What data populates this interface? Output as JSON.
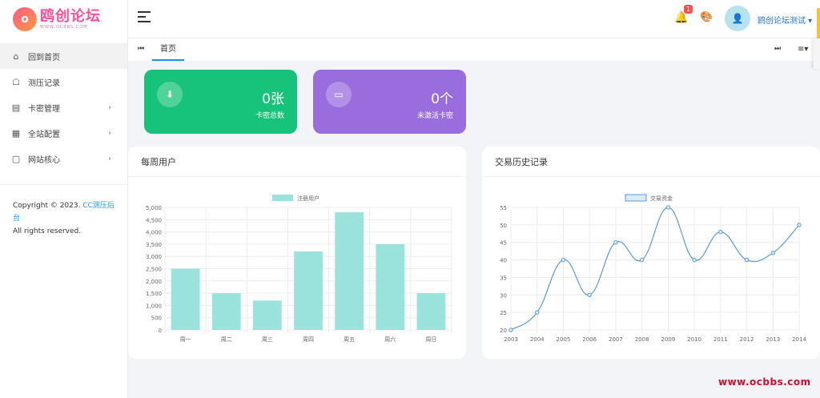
{
  "logo": {
    "title": "鸥创论坛",
    "subtitle": "WWW.OCBBS.COM",
    "mark": "o"
  },
  "sidebar": {
    "items": [
      {
        "label": "回到首页",
        "icon": "home-icon",
        "glyph": "⌂"
      },
      {
        "label": "测压记录",
        "icon": "record-icon",
        "glyph": "☖"
      },
      {
        "label": "卡密管理",
        "icon": "card-icon",
        "glyph": "▤",
        "arrow": "›"
      },
      {
        "label": "全站配置",
        "icon": "calendar-icon",
        "glyph": "▦",
        "arrow": "›"
      },
      {
        "label": "网站核心",
        "icon": "file-icon",
        "glyph": "▢",
        "arrow": "›"
      }
    ]
  },
  "copyright": {
    "prefix": "Copyright © 2023. ",
    "brand": "CC测压后台",
    "suffix": "All rights reserved."
  },
  "header": {
    "bell_glyph": "🔔",
    "notification_count": "1",
    "palette_glyph": "🎨",
    "avatar_glyph": "👤",
    "username": "鸥创论坛测试 ▾"
  },
  "tabs": {
    "first_glyph": "⏮",
    "home": "首页",
    "last_glyph": "⏭",
    "menu_glyph": "≡▾"
  },
  "stats": [
    {
      "value": "0张",
      "label": "卡密总数",
      "glyph": "⬇",
      "color": "#17c37a"
    },
    {
      "value": "0个",
      "label": "未激活卡密",
      "glyph": "▭",
      "color": "#9a6ddf"
    }
  ],
  "cards": {
    "weekly_title": "每周用户",
    "history_title": "交易历史记录"
  },
  "chart_data": [
    {
      "type": "bar",
      "title": "每周用户",
      "categories": [
        "周一",
        "周二",
        "周三",
        "周四",
        "周五",
        "周六",
        "周日"
      ],
      "series": [
        {
          "name": "注册用户",
          "values": [
            2500,
            1500,
            1200,
            3200,
            4800,
            3500,
            1500
          ]
        }
      ],
      "ylim": [
        0,
        5000
      ],
      "yticks": [
        "0",
        "500",
        "1,000",
        "1,500",
        "2,000",
        "2,500",
        "3,000",
        "3,500",
        "4,000",
        "4,500",
        "5,000"
      ],
      "grid": true,
      "legend": "top-center",
      "color": "#99e3dc"
    },
    {
      "type": "line",
      "title": "交易历史记录",
      "x": [
        "2003",
        "2004",
        "2005",
        "2006",
        "2007",
        "2008",
        "2009",
        "2010",
        "2011",
        "2012",
        "2013",
        "2014"
      ],
      "series": [
        {
          "name": "交易资金",
          "values": [
            20,
            25,
            40,
            30,
            45,
            40,
            55,
            40,
            48,
            40,
            42,
            50
          ]
        }
      ],
      "ylim": [
        20,
        55
      ],
      "yticks": [
        "20",
        "25",
        "30",
        "35",
        "40",
        "45",
        "50",
        "55"
      ],
      "grid": true,
      "legend": "top-center",
      "color": "#5b9bd5"
    }
  ],
  "watermark": "www.ocbbs.com"
}
